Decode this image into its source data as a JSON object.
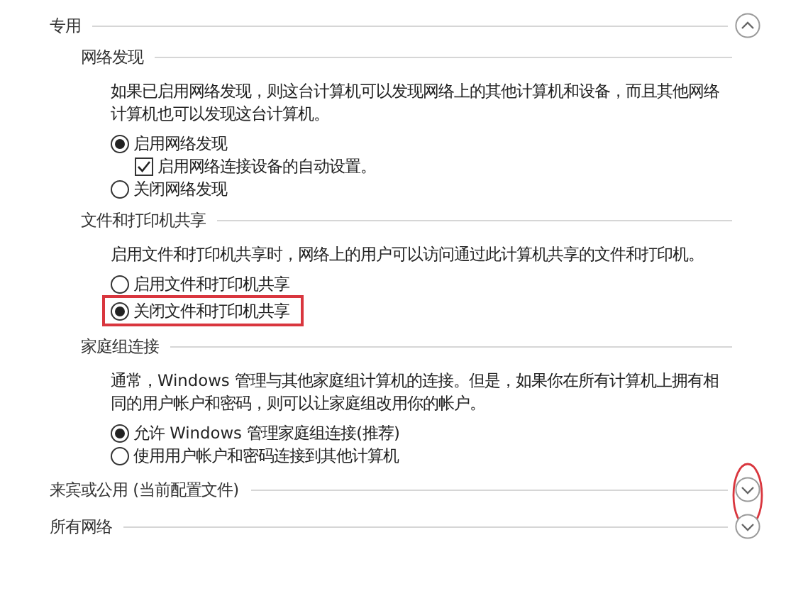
{
  "profiles": [
    {
      "title": "专用",
      "expanded": true,
      "circled": false,
      "sections": [
        {
          "heading": "网络发现",
          "description": "如果已启用网络发现，则这台计算机可以发现网络上的其他计算机和设备，而且其他网络计算机也可以发现这台计算机。",
          "options": [
            {
              "label": "启用网络发现",
              "selected": true,
              "highlighted": false,
              "children": [
                {
                  "label": "启用网络连接设备的自动设置。",
                  "checked": true
                }
              ]
            },
            {
              "label": "关闭网络发现",
              "selected": false,
              "highlighted": false
            }
          ]
        },
        {
          "heading": "文件和打印机共享",
          "description": "启用文件和打印机共享时，网络上的用户可以访问通过此计算机共享的文件和打印机。",
          "options": [
            {
              "label": "启用文件和打印机共享",
              "selected": false,
              "highlighted": false
            },
            {
              "label": "关闭文件和打印机共享",
              "selected": true,
              "highlighted": true
            }
          ]
        },
        {
          "heading": "家庭组连接",
          "description": "通常，Windows 管理与其他家庭组计算机的连接。但是，如果你在所有计算机上拥有相同的用户帐户和密码，则可以让家庭组改用你的帐户。",
          "options": [
            {
              "label": "允许 Windows 管理家庭组连接(推荐)",
              "selected": true,
              "highlighted": false
            },
            {
              "label": "使用用户帐户和密码连接到其他计算机",
              "selected": false,
              "highlighted": false
            }
          ]
        }
      ]
    },
    {
      "title": "来宾或公用 (当前配置文件)",
      "expanded": false,
      "circled": true
    },
    {
      "title": "所有网络",
      "expanded": false,
      "circled": false
    }
  ]
}
